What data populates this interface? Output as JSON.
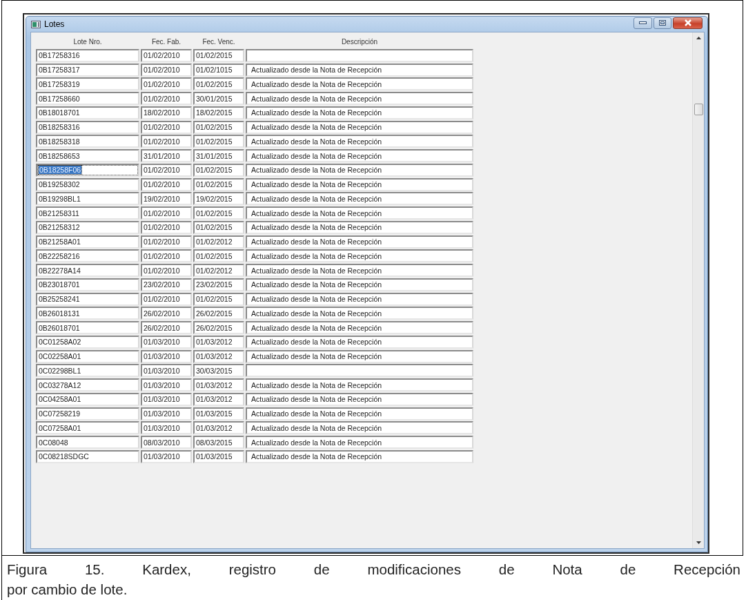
{
  "window": {
    "title": "Lotes"
  },
  "table": {
    "columns": [
      "Lote Nro.",
      "Fec. Fab.",
      "Fec. Venc.",
      "Descripción"
    ],
    "rows": [
      {
        "lote": "0B17258316",
        "fec_fab": "01/02/2010",
        "fec_venc": "01/02/2015",
        "selected": false
      },
      {
        "lote": "0B17258317",
        "fec_fab": "01/02/2010",
        "fec_venc": "01/02/1015",
        "descripcion": "Actualizado desde la Nota de Recepción",
        "selected": false
      },
      {
        "lote": "0B17258319",
        "fec_fab": "01/02/2010",
        "fec_venc": "01/02/2015",
        "descripcion": "Actualizado desde la Nota de Recepción",
        "selected": false
      },
      {
        "lote": "0B17258660",
        "fec_fab": "01/02/2010",
        "fec_venc": "30/01/2015",
        "descripcion": "Actualizado desde la Nota de Recepción",
        "selected": false
      },
      {
        "lote": "0B18018701",
        "fec_fab": "18/02/2010",
        "fec_venc": "18/02/2015",
        "descripcion": "Actualizado desde la Nota de Recepción",
        "selected": false
      },
      {
        "lote": "0B18258316",
        "fec_fab": "01/02/2010",
        "fec_venc": "01/02/2015",
        "descripcion": "Actualizado desde la Nota de Recepción",
        "selected": false
      },
      {
        "lote": "0B18258318",
        "fec_fab": "01/02/2010",
        "fec_venc": "01/02/2015",
        "descripcion": "Actualizado desde la Nota de Recepción",
        "selected": false
      },
      {
        "lote": "0B18258653",
        "fec_fab": "31/01/2010",
        "fec_venc": "31/01/2015",
        "descripcion": "Actualizado desde la Nota de Recepción",
        "selected": false
      },
      {
        "lote": "0B18258F06",
        "fec_fab": "01/02/2010",
        "fec_venc": "01/02/2015",
        "descripcion": "Actualizado desde la Nota de Recepción",
        "selected": true
      },
      {
        "lote": "0B19258302",
        "fec_fab": "01/02/2010",
        "fec_venc": "01/02/2015",
        "descripcion": "Actualizado desde la Nota de Recepción",
        "selected": false
      },
      {
        "lote": "0B19298BL1",
        "fec_fab": "19/02/2010",
        "fec_venc": "19/02/2015",
        "descripcion": "Actualizado desde la Nota de Recepción",
        "selected": false
      },
      {
        "lote": "0B21258311",
        "fec_fab": "01/02/2010",
        "fec_venc": "01/02/2015",
        "descripcion": "Actualizado desde la Nota de Recepción",
        "selected": false
      },
      {
        "lote": "0B21258312",
        "fec_fab": "01/02/2010",
        "fec_venc": "01/02/2015",
        "descripcion": "Actualizado desde la Nota de Recepción",
        "selected": false
      },
      {
        "lote": "0B21258A01",
        "fec_fab": "01/02/2010",
        "fec_venc": "01/02/2012",
        "descripcion": "Actualizado desde la Nota de Recepción",
        "selected": false
      },
      {
        "lote": "0B22258216",
        "fec_fab": "01/02/2010",
        "fec_venc": "01/02/2015",
        "descripcion": "Actualizado desde la Nota de Recepción",
        "selected": false
      },
      {
        "lote": "0B22278A14",
        "fec_fab": "01/02/2010",
        "fec_venc": "01/02/2012",
        "descripcion": "Actualizado desde la Nota de Recepción",
        "selected": false
      },
      {
        "lote": "0B23018701",
        "fec_fab": "23/02/2010",
        "fec_venc": "23/02/2015",
        "descripcion": "Actualizado desde la Nota de Recepción",
        "selected": false
      },
      {
        "lote": "0B25258241",
        "fec_fab": "01/02/2010",
        "fec_venc": "01/02/2015",
        "descripcion": "Actualizado desde la Nota de Recepción",
        "selected": false
      },
      {
        "lote": "0B26018131",
        "fec_fab": "26/02/2010",
        "fec_venc": "26/02/2015",
        "descripcion": "Actualizado desde la Nota de Recepción",
        "selected": false
      },
      {
        "lote": "0B26018701",
        "fec_fab": "26/02/2010",
        "fec_venc": "26/02/2015",
        "descripcion": "Actualizado desde la Nota de Recepción",
        "selected": false
      },
      {
        "lote": "0C01258A02",
        "fec_fab": "01/03/2010",
        "fec_venc": "01/03/2012",
        "descripcion": "Actualizado desde la Nota de Recepción",
        "selected": false
      },
      {
        "lote": "0C02258A01",
        "fec_fab": "01/03/2010",
        "fec_venc": "01/03/2012",
        "descripcion": "Actualizado desde la Nota de Recepción",
        "selected": false
      },
      {
        "lote": "0C02298BL1",
        "fec_fab": "01/03/2010",
        "fec_venc": "30/03/2015",
        "selected": false
      },
      {
        "lote": "0C03278A12",
        "fec_fab": "01/03/2010",
        "fec_venc": "01/03/2012",
        "descripcion": "Actualizado desde la Nota de Recepción",
        "selected": false
      },
      {
        "lote": "0C04258A01",
        "fec_fab": "01/03/2010",
        "fec_venc": "01/03/2012",
        "descripcion": "Actualizado desde la Nota de Recepción",
        "selected": false
      },
      {
        "lote": "0C07258219",
        "fec_fab": "01/03/2010",
        "fec_venc": "01/03/2015",
        "descripcion": "Actualizado desde la Nota de Recepción",
        "selected": false
      },
      {
        "lote": "0C07258A01",
        "fec_fab": "01/03/2010",
        "fec_venc": "01/03/2012",
        "descripcion": "Actualizado desde la Nota de Recepción",
        "selected": false
      },
      {
        "lote": "0C08048",
        "fec_fab": "08/03/2010",
        "fec_venc": "08/03/2015",
        "descripcion": "Actualizado desde la Nota de Recepción",
        "selected": false
      },
      {
        "lote": "0C08218SDGC",
        "fec_fab": "01/03/2010",
        "fec_venc": "01/03/2015",
        "descripcion": "Actualizado desde la Nota de Recepción",
        "selected": false
      }
    ]
  },
  "caption": "Figura 15. Kardex, registro de modificaciones de Nota de Recepción  por cambio de lote."
}
